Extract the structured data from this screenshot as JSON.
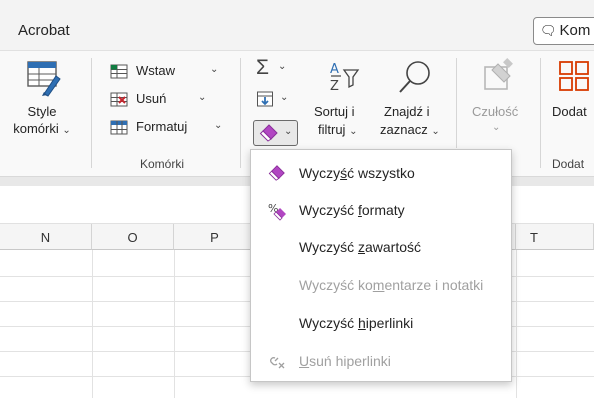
{
  "tabs": {
    "acrobat": "Acrobat"
  },
  "comment_button": {
    "label": "Kom"
  },
  "ribbon": {
    "style_button": {
      "line1": "Style",
      "line2": "komórki"
    },
    "cells": {
      "insert": "Wstaw",
      "delete": "Usuń",
      "format": "Formatuj",
      "group_label": "Komórki"
    },
    "editing": {
      "sum_symbol": "Σ",
      "sort_filter": {
        "line1": "Sortuj i",
        "line2": "filtruj"
      },
      "find_select": {
        "line1": "Znajdź i",
        "line2": "zaznacz"
      }
    },
    "sensitivity": {
      "label": "Czułość"
    },
    "addins": {
      "label": "Dodat",
      "group_label": "Dodat"
    }
  },
  "columns": [
    "N",
    "O",
    "P",
    "T"
  ],
  "clear_menu": {
    "items": [
      {
        "pre": "Wyczy",
        "key": "ś",
        "post": "ć wszystko",
        "enabled": true
      },
      {
        "pre": "Wyczyść ",
        "key": "f",
        "post": "ormaty",
        "enabled": true
      },
      {
        "pre": "Wyczyść ",
        "key": "z",
        "post": "awartość",
        "enabled": true
      },
      {
        "pre": "Wyczyść ko",
        "key": "m",
        "post": "entarze i notatki",
        "enabled": false
      },
      {
        "pre": "Wyczyść ",
        "key": "h",
        "post": "iperlinki",
        "enabled": true
      },
      {
        "pre": "",
        "key": "U",
        "post": "suń hiperlinki",
        "enabled": false
      }
    ]
  },
  "colors": {
    "accent_green": "#107c41",
    "eraser_purple": "#b146c2",
    "addin_orange": "#d83b01"
  },
  "icons": [
    "cell-styles-icon",
    "insert-cells-icon",
    "delete-cells-icon",
    "format-cells-icon",
    "autosum-icon",
    "fill-icon",
    "clear-eraser-icon",
    "sort-filter-icon",
    "find-select-icon",
    "sensitivity-icon",
    "addins-icon",
    "clear-formats-icon",
    "remove-hyperlinks-icon",
    "comment-icon"
  ]
}
